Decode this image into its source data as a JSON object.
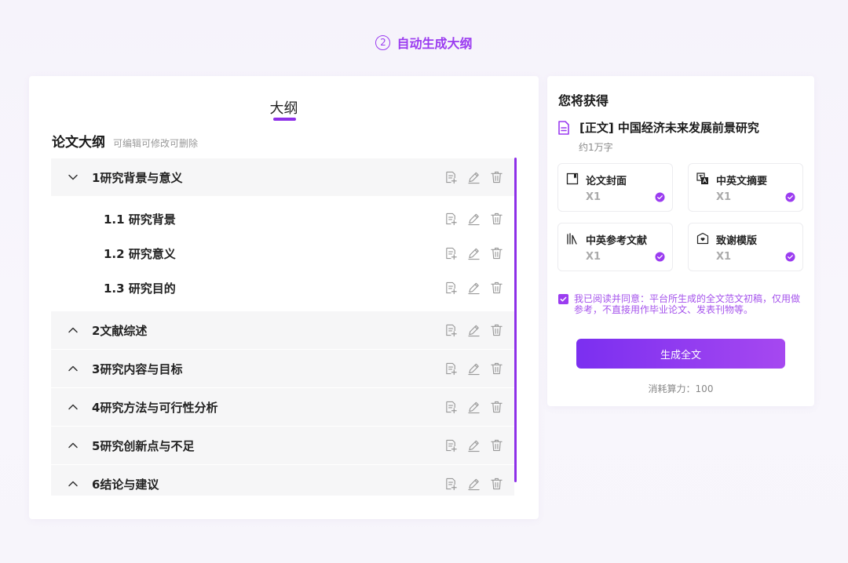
{
  "step": {
    "number": "2",
    "title": "自动生成大纲"
  },
  "outline": {
    "tab_title": "大纲",
    "header": "论文大纲",
    "hint": "可编辑可修改可删除",
    "sections": [
      {
        "label": "1研究背景与意义",
        "expanded": true,
        "subs": [
          "1.1 研究背景",
          "1.2 研究意义",
          "1.3 研究目的"
        ]
      },
      {
        "label": "2文献综述",
        "expanded": false,
        "subs": []
      },
      {
        "label": "3研究内容与目标",
        "expanded": false,
        "subs": []
      },
      {
        "label": "4研究方法与可行性分析",
        "expanded": false,
        "subs": []
      },
      {
        "label": "5研究创新点与不足",
        "expanded": false,
        "subs": []
      },
      {
        "label": "6结论与建议",
        "expanded": false,
        "subs": []
      }
    ]
  },
  "summary": {
    "heading": "您将获得",
    "doc_title": "[正文] 中国经济未来发展前景研究",
    "doc_sub": "约1万字",
    "tiles": [
      {
        "name": "论文封面",
        "qty": "X1",
        "icon": "cover-icon"
      },
      {
        "name": "中英文摘要",
        "qty": "X1",
        "icon": "translate-icon"
      },
      {
        "name": "中英参考文献",
        "qty": "X1",
        "icon": "books-icon"
      },
      {
        "name": "致谢模版",
        "qty": "X1",
        "icon": "thanks-icon"
      }
    ],
    "agreement": "我已阅读并同意：平台所生成的全文范文初稿，仅用做参考，不直接用作毕业论文、发表刊物等。",
    "generate_label": "生成全文",
    "cost": "消耗算力：100"
  },
  "colors": {
    "accent": "#8d2fe8",
    "accent_light": "#a553ec",
    "section_bg": "#f6f6f7"
  }
}
